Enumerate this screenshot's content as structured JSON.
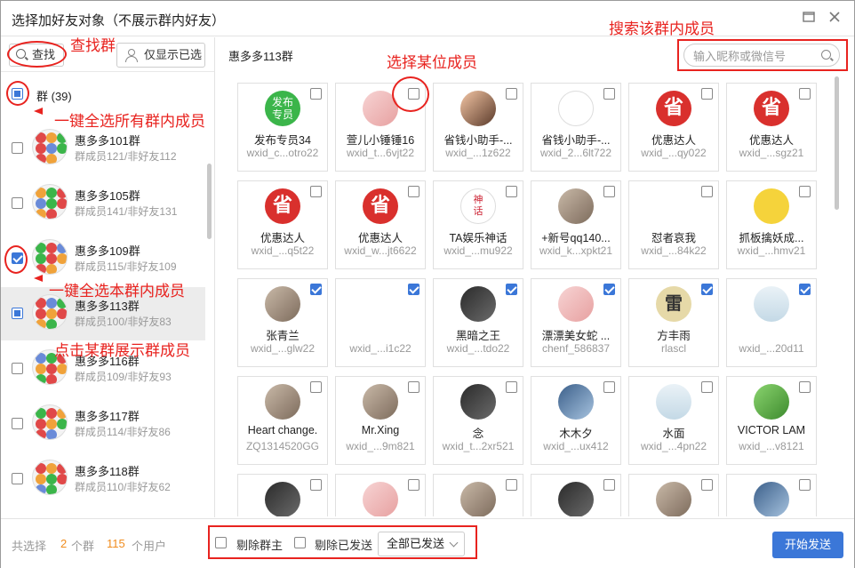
{
  "window": {
    "title": "选择加好友对象（不展示群内好友）"
  },
  "left": {
    "search_label": "查找",
    "only_selected_label": "仅显示已选",
    "all_groups_label": "群 (39)",
    "groups": [
      {
        "name": "惠多多101群",
        "sub": "群成员121/非好友112",
        "state": "unchecked"
      },
      {
        "name": "惠多多105群",
        "sub": "群成员141/非好友131",
        "state": "unchecked"
      },
      {
        "name": "惠多多109群",
        "sub": "群成员115/非好友109",
        "state": "checked"
      },
      {
        "name": "惠多多113群",
        "sub": "群成员100/非好友83",
        "state": "partial"
      },
      {
        "name": "惠多多116群",
        "sub": "群成员109/非好友93",
        "state": "unchecked"
      },
      {
        "name": "惠多多117群",
        "sub": "群成员114/非好友86",
        "state": "unchecked"
      },
      {
        "name": "惠多多118群",
        "sub": "群成员110/非好友62",
        "state": "unchecked"
      }
    ]
  },
  "right": {
    "current_group": "惠多多113群",
    "search_placeholder": "输入昵称或微信号",
    "members": [
      {
        "name": "发布专员34",
        "wxid": "wxid_c...otro22",
        "avatar": "fabu",
        "avatar_text": "发布\n专员",
        "checked": false
      },
      {
        "name": "萱儿小锤锤16",
        "wxid": "wxid_t...6vjt22",
        "avatar": "pink",
        "checked": false
      },
      {
        "name": "省钱小助手-...",
        "wxid": "wxid_...1z622",
        "avatar": "anime",
        "checked": false
      },
      {
        "name": "省钱小助手-...",
        "wxid": "wxid_2...6lt722",
        "avatar": "face",
        "checked": false
      },
      {
        "name": "优惠达人",
        "wxid": "wxid_...qy022",
        "avatar": "sheng",
        "avatar_text": "省",
        "checked": false
      },
      {
        "name": "优惠达人",
        "wxid": "wxid_...sgz21",
        "avatar": "sheng",
        "avatar_text": "省",
        "checked": false
      },
      {
        "name": "优惠达人",
        "wxid": "wxid_...q5t22",
        "avatar": "sheng",
        "avatar_text": "省",
        "checked": false
      },
      {
        "name": "优惠达人",
        "wxid": "wxid_w...jt6622",
        "avatar": "sheng",
        "avatar_text": "省",
        "checked": false
      },
      {
        "name": "TA娱乐神话",
        "wxid": "wxid_...mu922",
        "avatar": "shenhua",
        "avatar_text": "神\n话",
        "checked": false
      },
      {
        "name": "+新号qq140...",
        "wxid": "wxid_k...xpkt21",
        "avatar": "photo",
        "checked": false
      },
      {
        "name": "怼者哀我",
        "wxid": "wxid_...84k22",
        "avatar": "blank",
        "checked": false
      },
      {
        "name": "抓板擒妖成...",
        "wxid": "wxid_...hmv21",
        "avatar": "yellow",
        "checked": false
      },
      {
        "name": "张青兰",
        "wxid": "wxid_...glw22",
        "avatar": "photo",
        "checked": true
      },
      {
        "name": "",
        "wxid": "wxid_...i1c22",
        "avatar": "blank",
        "checked": true
      },
      {
        "name": "黑暗之王",
        "wxid": "wxid_...tdo22",
        "avatar": "dark",
        "checked": true
      },
      {
        "name": "漂漂美女蛇 ...",
        "wxid": "chenf_586837",
        "avatar": "pink",
        "checked": true
      },
      {
        "name": "方丰雨",
        "wxid": "rlascl",
        "avatar": "lei",
        "avatar_text": "雷",
        "checked": true
      },
      {
        "name": "",
        "wxid": "wxid_...20d11",
        "avatar": "light",
        "checked": true
      },
      {
        "name": "Heart change.",
        "wxid": "ZQ1314520GG",
        "avatar": "photo",
        "checked": false
      },
      {
        "name": "Mr.Xing",
        "wxid": "wxid_...9m821",
        "avatar": "photo",
        "checked": false
      },
      {
        "name": "念",
        "wxid": "wxid_t...2xr521",
        "avatar": "dark",
        "checked": false
      },
      {
        "name": "木木夕",
        "wxid": "wxid_...ux412",
        "avatar": "blue",
        "checked": false
      },
      {
        "name": "水面",
        "wxid": "wxid_...4pn22",
        "avatar": "light",
        "checked": false
      },
      {
        "name": "VICTOR LAM",
        "wxid": "wxid_...v8121",
        "avatar": "green",
        "checked": false
      },
      {
        "name": "",
        "wxid": "",
        "avatar": "dark",
        "checked": false
      },
      {
        "name": "",
        "wxid": "",
        "avatar": "pink",
        "checked": false
      },
      {
        "name": "",
        "wxid": "",
        "avatar": "photo",
        "checked": false
      },
      {
        "name": "",
        "wxid": "",
        "avatar": "dark",
        "checked": false
      },
      {
        "name": "",
        "wxid": "",
        "avatar": "photo",
        "checked": false
      },
      {
        "name": "",
        "wxid": "",
        "avatar": "blue",
        "checked": false
      }
    ]
  },
  "bottom": {
    "total_label": "共选择",
    "group_count": "2",
    "group_unit": "个群",
    "user_count": "115",
    "user_unit": "个用户",
    "exclude_owner_label": "剔除群主",
    "exclude_sent_label": "剔除已发送",
    "send_filter_value": "全部已发送",
    "send_button": "开始发送"
  },
  "annotations": {
    "find_group": "查找群",
    "select_all_groups": "一键全选所有群内成员",
    "select_all_in_group": "一键全选本群内成员",
    "click_group": "点击某群展示群成员",
    "select_member": "选择某位成员",
    "search_member": "搜索该群内成员"
  },
  "colors": {
    "accent": "#3b77d8",
    "annotation": "#e8231f",
    "count_highlight": "#f08c1e"
  }
}
